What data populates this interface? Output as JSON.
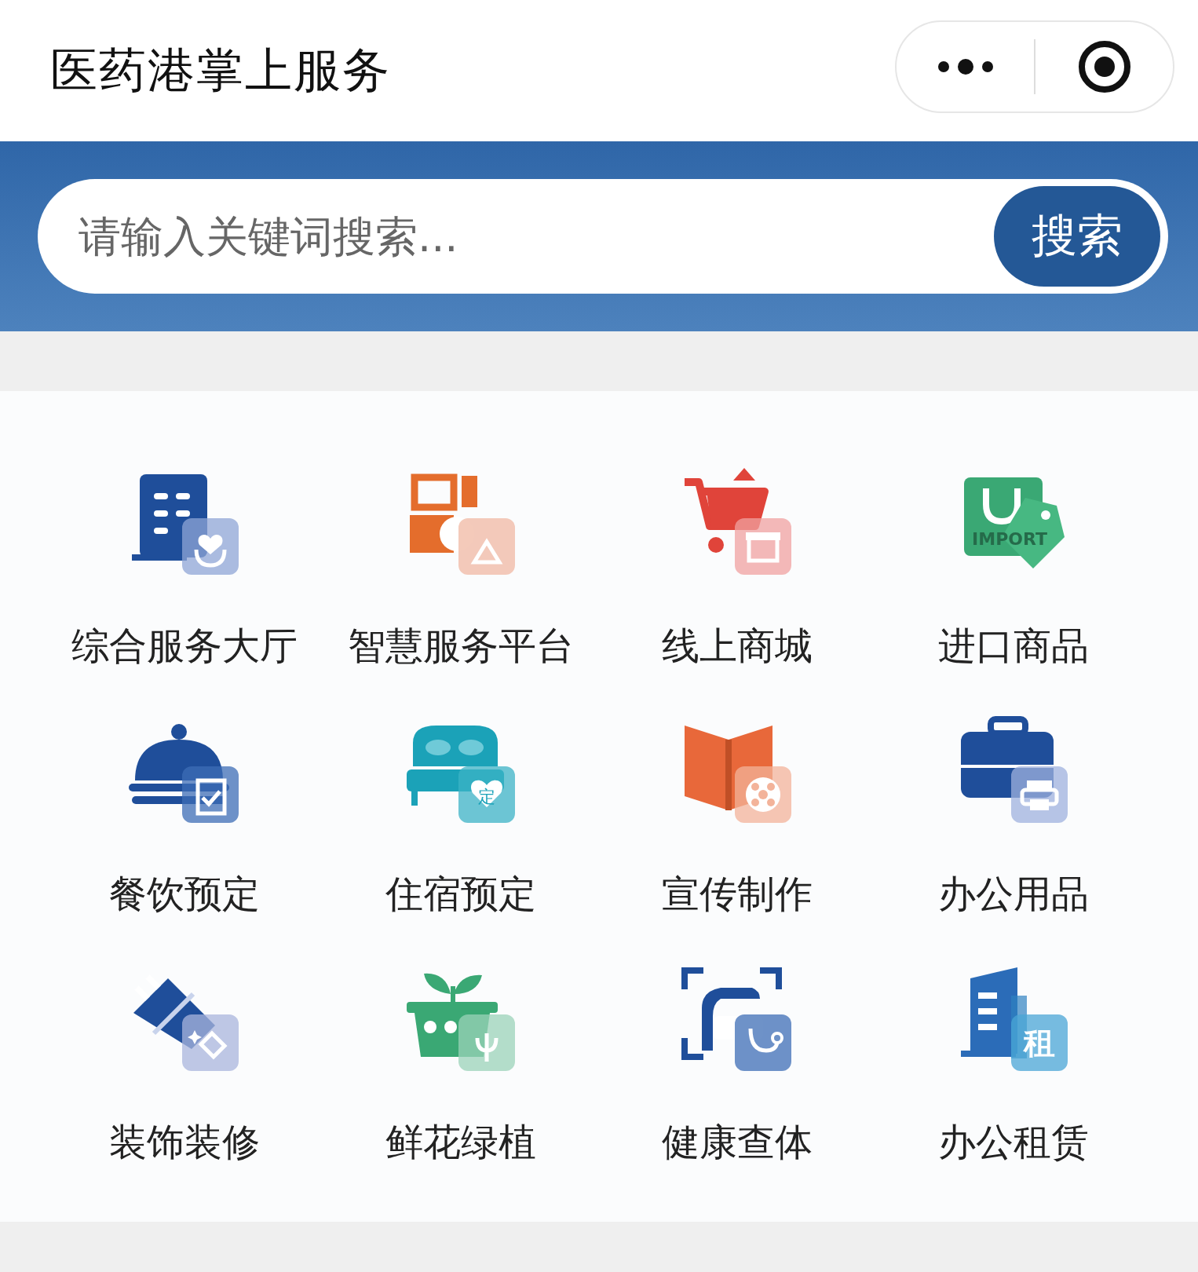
{
  "header": {
    "title": "医药港掌上服务"
  },
  "search": {
    "placeholder": "请输入关键词搜索...",
    "button": "搜索"
  },
  "services": [
    {
      "kind": "hall",
      "label": "综合服务大厅"
    },
    {
      "kind": "platform",
      "label": "智慧服务平台"
    },
    {
      "kind": "mall",
      "label": "线上商城"
    },
    {
      "kind": "import",
      "label": "进口商品",
      "icon_text": "IMPORT"
    },
    {
      "kind": "dining",
      "label": "餐饮预定"
    },
    {
      "kind": "lodging",
      "label": "住宿预定",
      "icon_text": "定"
    },
    {
      "kind": "publicity",
      "label": "宣传制作"
    },
    {
      "kind": "office",
      "label": "办公用品"
    },
    {
      "kind": "decoration",
      "label": "装饰装修"
    },
    {
      "kind": "plants",
      "label": "鲜花绿植"
    },
    {
      "kind": "health",
      "label": "健康查体"
    },
    {
      "kind": "rental",
      "label": "办公租赁",
      "icon_text": "租"
    }
  ]
}
